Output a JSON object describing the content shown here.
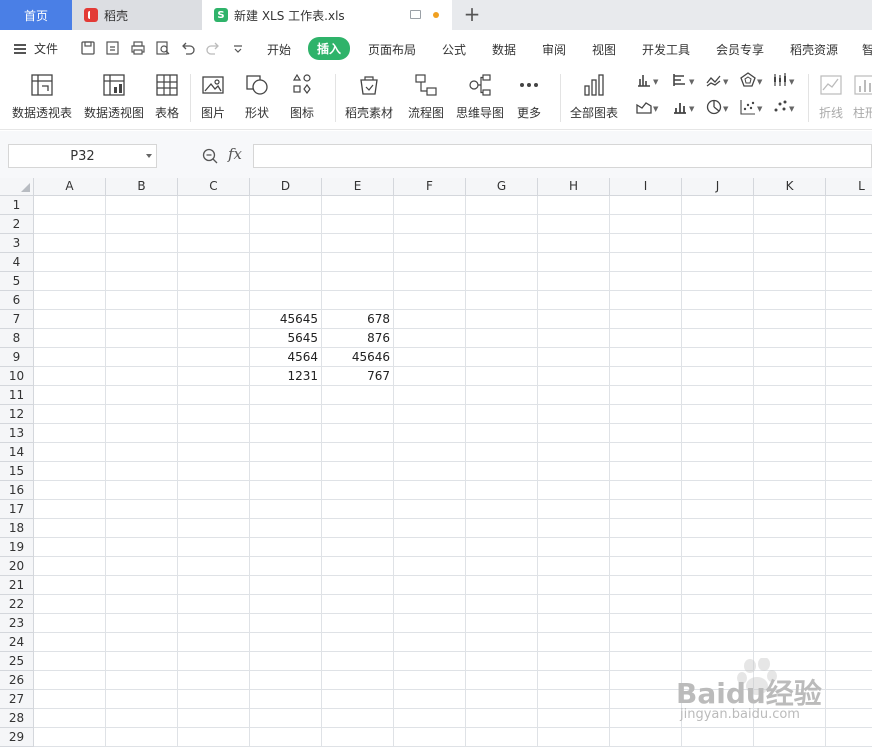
{
  "tabs": {
    "home": "首页",
    "daoke": "稻壳",
    "file": "新建 XLS 工作表.xls",
    "file_icon_letter": "S"
  },
  "menu": {
    "file_label": "文件",
    "items": [
      "开始",
      "插入",
      "页面布局",
      "公式",
      "数据",
      "审阅",
      "视图",
      "开发工具",
      "会员专享",
      "稻壳资源",
      "智"
    ],
    "active": "插入"
  },
  "ribbon": {
    "buttons": [
      "数据透视表",
      "数据透视图",
      "表格",
      "图片",
      "形状",
      "图标",
      "稻壳素材",
      "流程图",
      "思维导图",
      "更多",
      "全部图表",
      "折线",
      "柱形"
    ]
  },
  "formula_bar": {
    "name_box": "P32",
    "fx_label": "fx",
    "formula": ""
  },
  "sheet": {
    "columns": [
      "A",
      "B",
      "C",
      "D",
      "E",
      "F",
      "G",
      "H",
      "I",
      "J",
      "K",
      "L"
    ],
    "rows": [
      "1",
      "2",
      "3",
      "4",
      "5",
      "6",
      "7",
      "8",
      "9",
      "10",
      "11",
      "12",
      "13",
      "14",
      "15",
      "16",
      "17",
      "18",
      "19",
      "20",
      "21",
      "22",
      "23",
      "24",
      "25",
      "26",
      "27",
      "28",
      "29"
    ],
    "cells": [
      {
        "ref": "D7",
        "value": "45645"
      },
      {
        "ref": "E7",
        "value": "678"
      },
      {
        "ref": "D8",
        "value": "5645"
      },
      {
        "ref": "E8",
        "value": "876"
      },
      {
        "ref": "D9",
        "value": "4564"
      },
      {
        "ref": "E9",
        "value": "45646"
      },
      {
        "ref": "D10",
        "value": "1231"
      },
      {
        "ref": "E10",
        "value": "767"
      }
    ]
  },
  "watermark": {
    "text": "Baidu经验",
    "url": "jingyan.baidu.com"
  },
  "colors": {
    "home_tab": "#4a7fe6",
    "active_menu": "#2fb36a",
    "modified_dot": "#f0a020"
  }
}
